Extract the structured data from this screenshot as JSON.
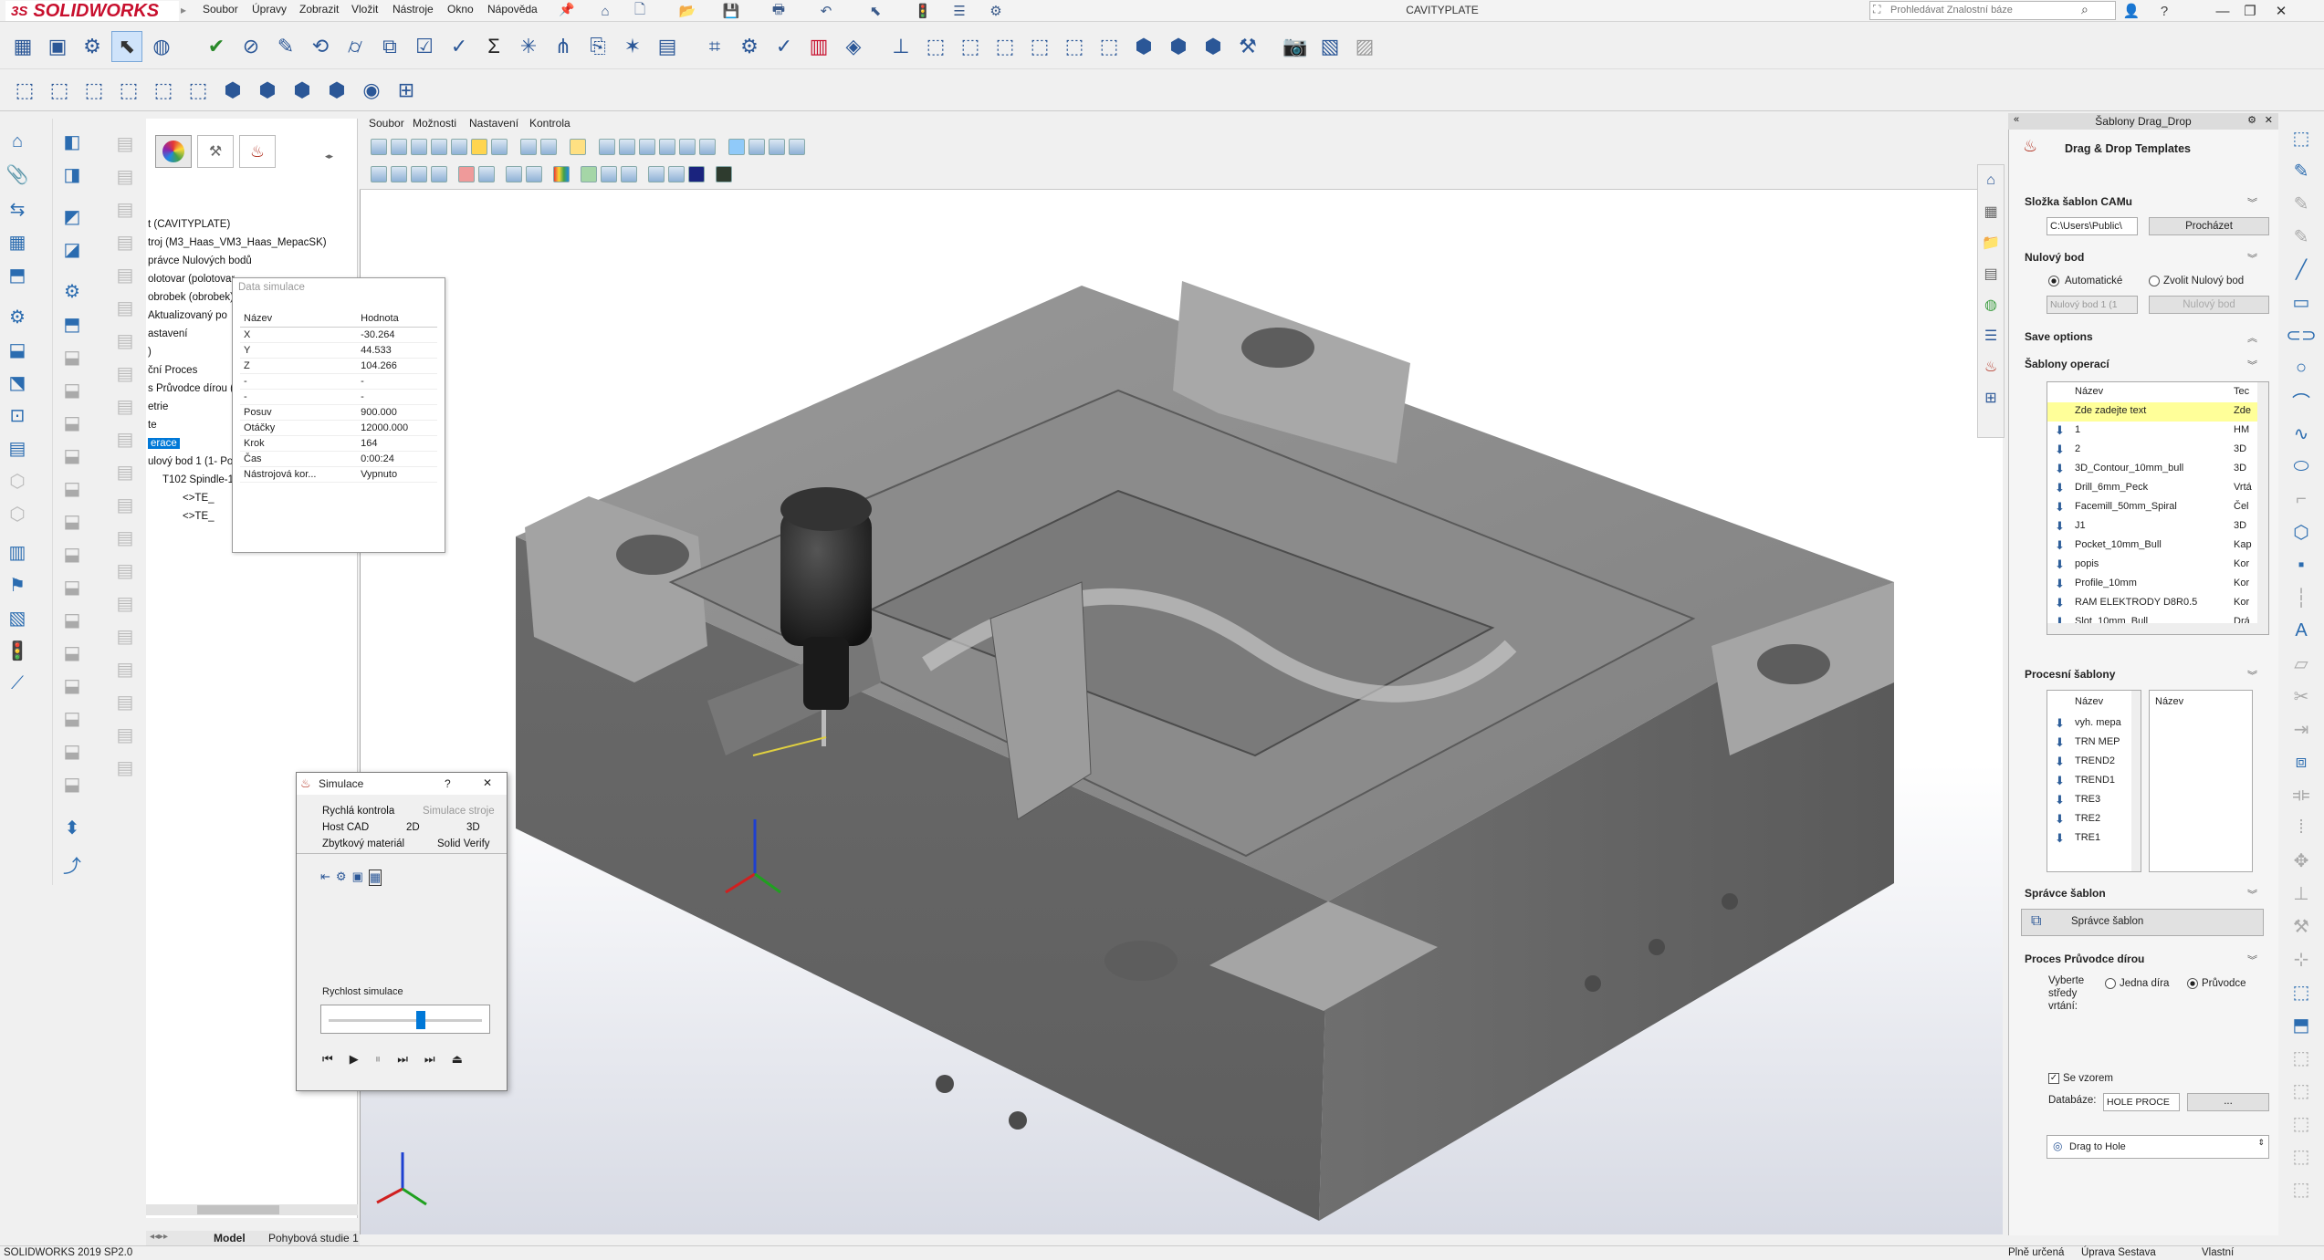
{
  "app": {
    "brand_ds": "3S",
    "brand": "SOLIDWORKS",
    "window_title": "CAVITYPLATE",
    "search_placeholder": "Prohledávat Znalostní báze"
  },
  "menubar": [
    "Soubor",
    "Úpravy",
    "Zobrazit",
    "Vložit",
    "Nástroje",
    "Okno",
    "Nápověda"
  ],
  "viewport_menu": [
    "Soubor",
    "Možnosti",
    "Nastavení",
    "Kontrola"
  ],
  "tree": {
    "lines": [
      "t (CAVITYPLATE)",
      "troj (M3_Haas_VM3_Haas_MepacSK)",
      "právce Nulových bodů",
      "olotovar (polotovar",
      "obrobek (obrobek)",
      "Aktualizovaný po",
      "astavení",
      ")",
      "ční Proces",
      "s Průvodce dírou (H",
      "etrie",
      "te",
      "erace",
      "ulový bod 1 (1- Pol",
      "T102 Spindle-1",
      "<>TE_",
      "<>TE_"
    ]
  },
  "data_simulace": {
    "title": "Data simulace",
    "headers": [
      "Název",
      "Hodnota"
    ],
    "rows": [
      [
        "X",
        "-30.264"
      ],
      [
        "Y",
        "44.533"
      ],
      [
        "Z",
        "104.266"
      ],
      [
        "-",
        "-"
      ],
      [
        "-",
        "-"
      ],
      [
        "Posuv",
        "900.000"
      ],
      [
        "Otáčky",
        "12000.000"
      ],
      [
        "Krok",
        "164"
      ],
      [
        "Čas",
        "0:00:24"
      ],
      [
        "Nástrojová kor...",
        "Vypnuto"
      ]
    ]
  },
  "simulace": {
    "title": "Simulace",
    "help": "?",
    "close": "✕",
    "tabs_row1": [
      "Rychlá kontrola",
      "Simulace stroje"
    ],
    "tabs_row2": [
      "Host CAD",
      "2D",
      "3D"
    ],
    "tabs_row3": [
      "Zbytkový materiál",
      "Solid Verify"
    ],
    "speed_label": "Rychlost simulace",
    "speed_fraction": 0.6
  },
  "right_pane": {
    "header": "Šablony Drag_Drop",
    "title": "Drag & Drop Templates",
    "slozka": {
      "title": "Složka šablon CAMu",
      "path": "C:\\Users\\Public\\",
      "browse": "Procházet"
    },
    "nulovy_bod": {
      "title": "Nulový bod",
      "opt_auto": "Automatické",
      "opt_choose": "Zvolit Nulový bod",
      "select_value": "Nulový bod 1 (1",
      "button": "Nulový bod"
    },
    "save_options": "Save options",
    "sablony_operaci": {
      "title": "Šablony operací",
      "col_name": "Název",
      "col_tech": "Tec",
      "rows": [
        [
          "Zde zadejte text",
          "Zde"
        ],
        [
          "1",
          "HM"
        ],
        [
          "2",
          "3D"
        ],
        [
          "3D_Contour_10mm_bull",
          "3D"
        ],
        [
          "Drill_6mm_Peck",
          "Vrtá"
        ],
        [
          "Facemill_50mm_Spiral",
          "Čel"
        ],
        [
          "J1",
          "3D"
        ],
        [
          "Pocket_10mm_Bull",
          "Kap"
        ],
        [
          "popis",
          "Kor"
        ],
        [
          "Profile_10mm",
          "Kor"
        ],
        [
          "RAM ELEKTRODY D8R0.5",
          "Kor"
        ],
        [
          "Slot_10mm_Bull",
          "Drá"
        ]
      ]
    },
    "procesni_sablony": {
      "title": "Procesní šablony",
      "col_left": "Název",
      "col_right": "Název",
      "rows": [
        "vyh. mepa",
        "TRN MEP",
        "TREND2",
        "TREND1",
        "TRE3",
        "TRE2",
        "TRE1"
      ]
    },
    "spravce_sablon": {
      "title": "Správce šablon",
      "button": "Správce šablon"
    },
    "proces_pruvodce": {
      "title": "Proces Průvodce dírou",
      "label": "Vyberte středy vrtání:",
      "opt_single": "Jedna díra",
      "opt_wizard": "Průvodce",
      "checkbox": "Se vzorem",
      "db_label": "Databáze:",
      "db_value": "HOLE PROCE",
      "dots": "...",
      "drag_label": "Drag to Hole"
    }
  },
  "bottom_tabs": [
    "Model",
    "Pohybová studie 1"
  ],
  "status": {
    "left": "SOLIDWORKS 2019 SP2.0",
    "mid1": "Plně určená",
    "mid2": "Úprava Sestava",
    "right": "Vlastní"
  },
  "colors": {
    "brand_red": "#c8102e",
    "highlight_yellow": "#ffff99",
    "selection_blue": "#0078d7",
    "model_gray": "#8c8c8c"
  }
}
